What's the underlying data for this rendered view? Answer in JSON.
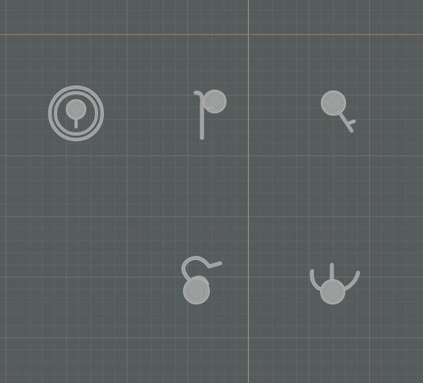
{
  "viewport": {
    "background_color": "#565b5b",
    "grid_minor_color": "#60656a",
    "grid_major_color": "#6a6f6f",
    "x_axis_color": "#c0664a",
    "y_axis_color": "#8ba64a"
  },
  "objects": [
    {
      "name": "ring-glyph",
      "icon": "ring-with-bulb-icon"
    },
    {
      "name": "p-glyph",
      "icon": "letter-p-icon"
    },
    {
      "name": "key-glyph",
      "icon": "key-icon"
    },
    {
      "name": "loop-bulb-glyph",
      "icon": "loop-over-bulb-icon"
    },
    {
      "name": "trident-glyph",
      "icon": "trident-bulb-icon"
    }
  ]
}
